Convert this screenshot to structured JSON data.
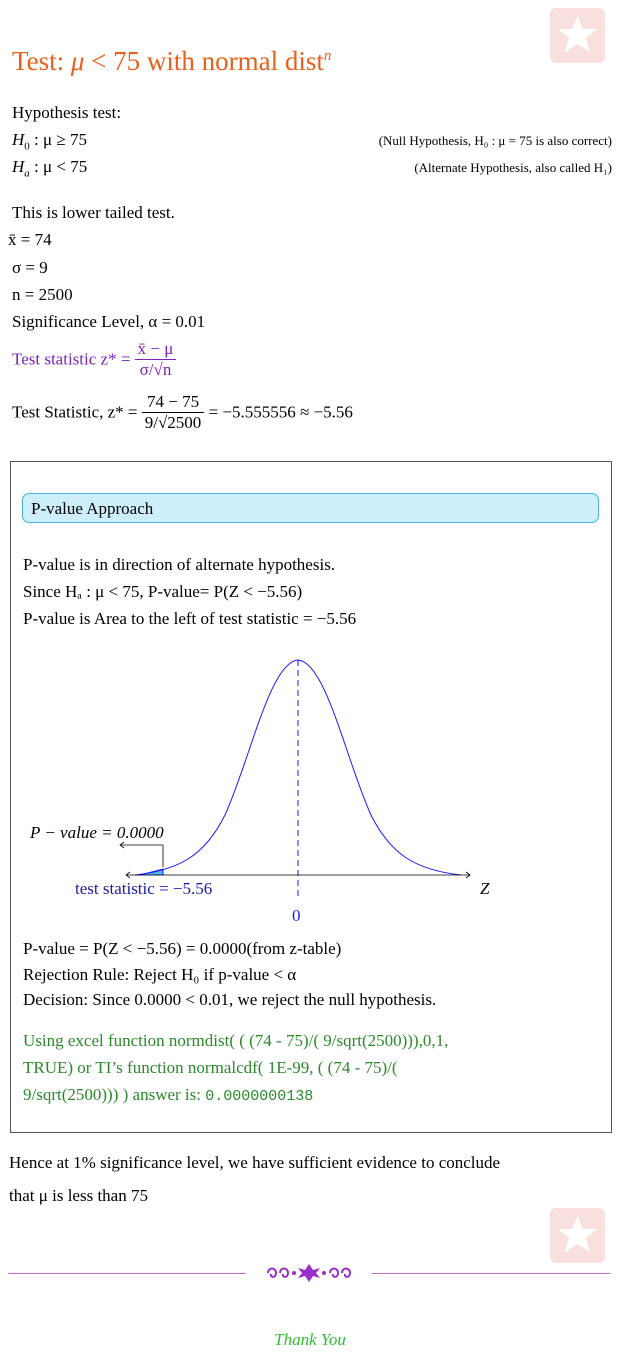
{
  "title": {
    "prefix": "Test: ",
    "mu": "μ",
    "rel": " < 75 with normal dist",
    "sup": "n"
  },
  "hypothesis": {
    "heading": "Hypothesis test:",
    "h0_label": "H",
    "h0_sub": "0",
    "h0_rest": " : μ ≥ 75",
    "h0_note": "(Null Hypothesis, H₀ : μ = 75 is also correct)",
    "ha_label": "H",
    "ha_sub": "a",
    "ha_rest": " : μ < 75",
    "ha_note": "(Alternate Hypothesis, also called H₁)"
  },
  "given": {
    "tail": "This is lower tailed test.",
    "xbar": "x̄ = 74",
    "sigma": "σ = 9",
    "n": "n = 2500",
    "alpha": "Significance Level, α = 0.01"
  },
  "formula": {
    "label": "Test statistic z* = ",
    "num": "x̄ − μ",
    "den": "σ/√n"
  },
  "computed": {
    "label": "Test Statistic, z* = ",
    "num": "74 − 75",
    "den": "9/√2500",
    "result": " = −5.555556 ≈ −5.56"
  },
  "pvalue_section": {
    "heading": "P-value Approach",
    "line1": "P-value is in direction of alternate hypothesis.",
    "line2": "Since Hₐ : μ < 75, P-value= P(Z < −5.56)",
    "line3": "P-value is Area to the left of test statistic = −5.56",
    "chart_pvalue": "P − value = 0.0000",
    "chart_teststat": "test statistic = −5.56",
    "chart_zero": "0",
    "chart_z": "Z",
    "result": "P-value = P(Z < −5.56) = 0.0000(from z-table)",
    "rule": "Rejection Rule: Reject H₀ if p-value < α",
    "decision": "Decision: Since 0.0000 < 0.01, we reject the null hypothesis.",
    "excel1": "Using excel function normdist( ( (74 - 75)/( 9/sqrt(2500))),0,1,",
    "excel2": "TRUE) or TI’s function normalcdf( 1E-99, ( (74 - 75)/(",
    "excel3": "9/sqrt(2500))) ) answer is: ",
    "answer": "0.0000000138"
  },
  "conclusion": {
    "line1": "Hence at 1% significance level, we have sufficient evidence to conclude",
    "line2": "that μ is less than 75"
  },
  "footer": {
    "thanks": "Thank You"
  },
  "colors": {
    "title": "#e8601c",
    "purple": "#7b22b8",
    "green": "#2a8a2a",
    "curve": "#1a1aff",
    "box_fill": "#cdeefa"
  }
}
